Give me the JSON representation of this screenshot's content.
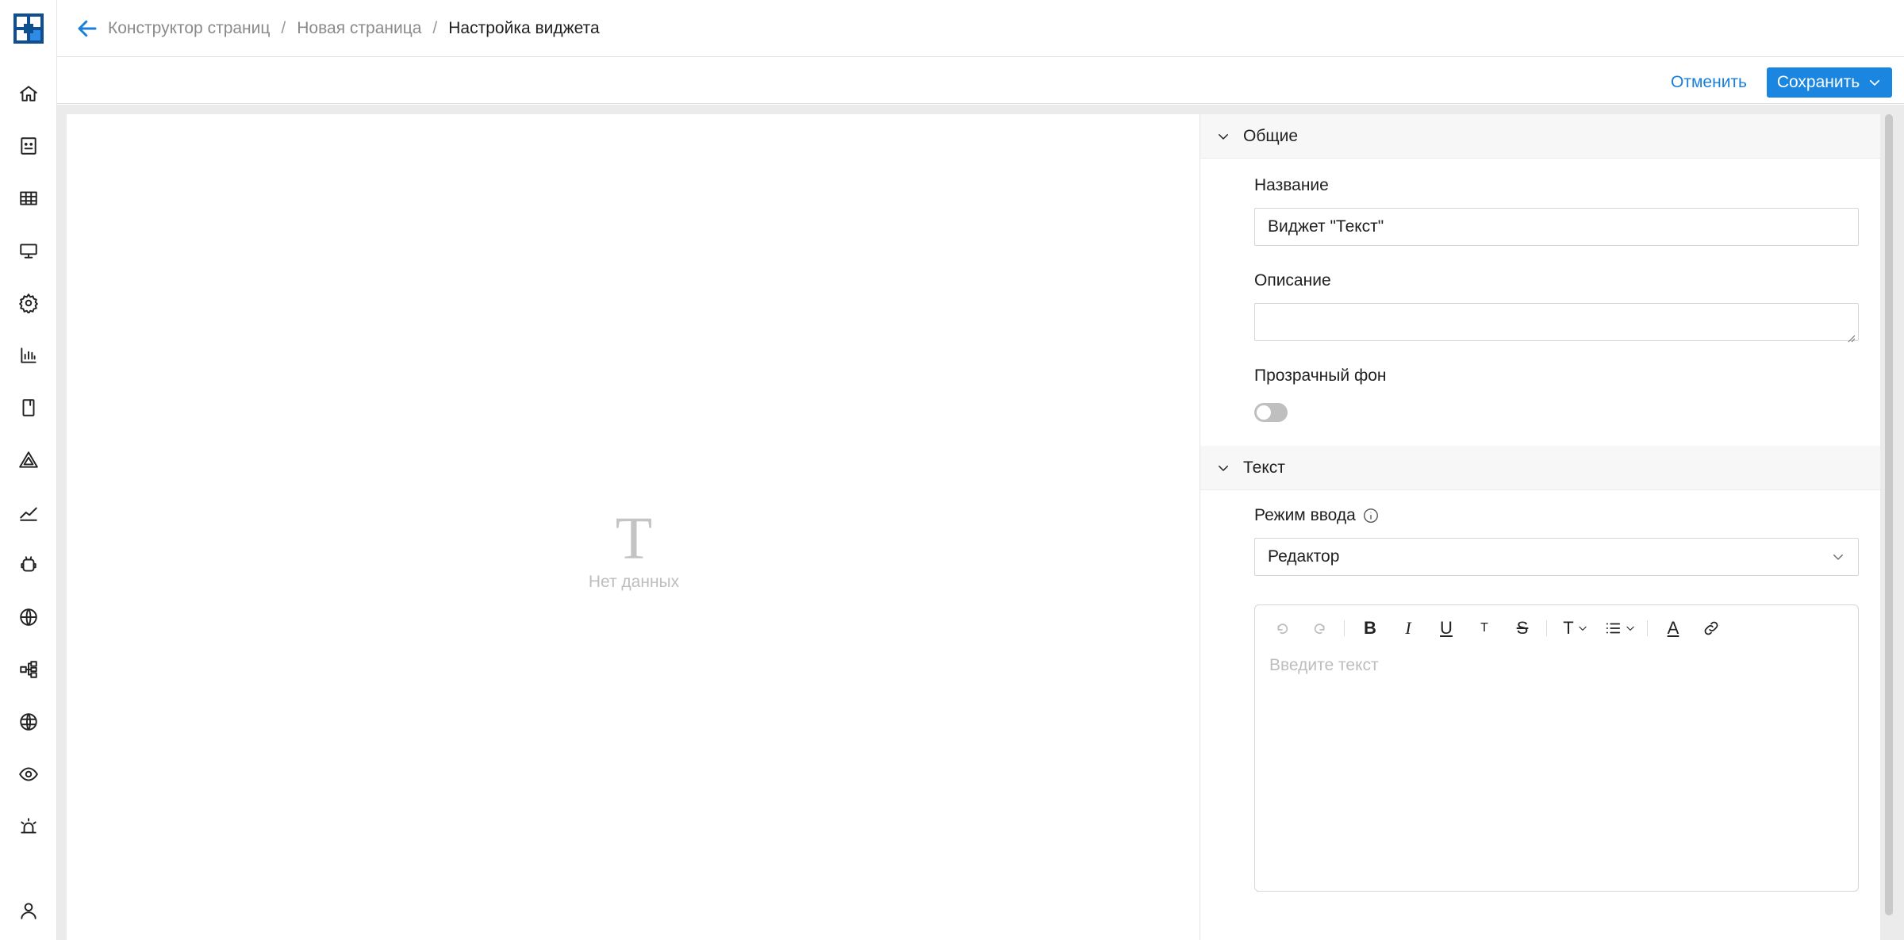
{
  "header": {
    "breadcrumbs": [
      {
        "label": "Конструктор страниц"
      },
      {
        "label": "Новая страница"
      },
      {
        "label": "Настройка виджета"
      }
    ],
    "separator": "/"
  },
  "toolbar": {
    "cancel_label": "Отменить",
    "save_label": "Сохранить"
  },
  "sidebar": {
    "items": [
      {
        "icon": "home-icon"
      },
      {
        "icon": "dashboard-icon"
      },
      {
        "icon": "table-icon"
      },
      {
        "icon": "monitor-icon"
      },
      {
        "icon": "gear-icon"
      },
      {
        "icon": "bar-chart-icon"
      },
      {
        "icon": "bookmark-icon"
      },
      {
        "icon": "pyramid-icon"
      },
      {
        "icon": "line-chart-icon"
      },
      {
        "icon": "robot-icon"
      },
      {
        "icon": "globe-icon"
      },
      {
        "icon": "hierarchy-icon"
      },
      {
        "icon": "network-globe-icon"
      },
      {
        "icon": "eye-icon"
      },
      {
        "icon": "alarm-icon"
      }
    ],
    "user_icon": "user-icon"
  },
  "canvas": {
    "empty_icon": "T",
    "empty_text": "Нет данных"
  },
  "panel": {
    "general": {
      "title": "Общие",
      "name_label": "Название",
      "name_value": "Виджет \"Текст\"",
      "description_label": "Описание",
      "description_value": "",
      "transparent_label": "Прозрачный фон",
      "transparent_on": false
    },
    "text": {
      "title": "Текст",
      "mode_label": "Режим ввода",
      "mode_value": "Редактор",
      "placeholder": "Введите текст",
      "toolbar": {
        "bold": "B",
        "italic": "I",
        "underline": "U",
        "small_caps": "T",
        "strike": "S",
        "heading": "T",
        "color": "A"
      }
    }
  },
  "colors": {
    "accent": "#1a86e0",
    "brand": "#0d4f91"
  }
}
